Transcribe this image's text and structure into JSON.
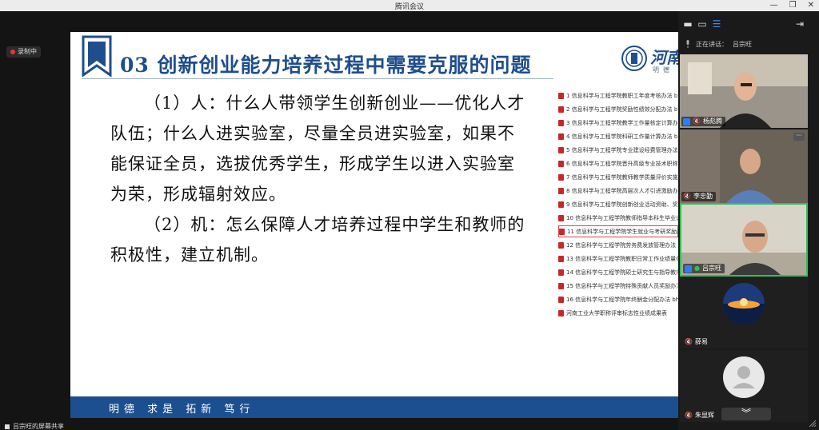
{
  "window": {
    "title": "腾讯会议",
    "controls": {
      "minimize": "—",
      "restore": "❐",
      "close": "✕"
    }
  },
  "recording": {
    "label": "录制中"
  },
  "slide": {
    "title": "03 创新创业能力培养过程中需要克服的问题",
    "logo_text": "河南",
    "logo_sub": "明德 求",
    "paragraphs": [
      [
        "（1）人：什么人带领学生创新创业——优化人才",
        "队伍；什么人进实验室，尽量全员进实验室，如果不",
        "能保证全员，选拔优秀学生，形成学生以进入实验室",
        "为荣，形成辐射效应。"
      ],
      [
        "（2）机：怎么保障人才培养过程中学生和教师的",
        "积极性，建立机制。"
      ]
    ],
    "footer_motto": "明德 求是 拓新 笃行",
    "colors": {
      "title": "#1f4e8c",
      "footer": "#1c4f8f"
    }
  },
  "file_list": {
    "items": [
      "1 信息科学与工程学院教职工年度考核办法 bh",
      "2 信息科学与工程学院奖励性绩效分配办法 bh",
      "3 信息科学与工程学院教学工作量核定计算办法",
      "4 信息科学与工程学院科研工作量计算办法 bh",
      "5 信息科学与工程学院专业建设经费管理办法 b",
      "6 信息科学与工程学院晋升高级专业技术职称入",
      "7 信息科学与工程学院教师教学质量评价实施办",
      "8 信息科学与工程学院高层次人才引进激励办法",
      "9 信息科学与工程学院创新创业活动资助、奖励",
      "10 信息科学与工程学院教师指导本科生毕业设",
      "11 信息科学与工程学院学生就业与考研奖励办",
      "12 信息科学与工程学院劳务费发放管理办法 bh",
      "13 信息科学与工程学院教职日常工作业绩量化",
      "14 信息科学与工程学院硕士研究生与指导教师",
      "15 信息科学与工程学院特殊贡献人员奖励办法",
      "16 信息科学与工程学院年终酬金分配办法 bh",
      "河南工业大学职称评审标志性业绩成果表"
    ],
    "highlighted_index": 10
  },
  "panel": {
    "speaking_label": "正在讲话：",
    "speaking_name": "吕宗旺",
    "participants": [
      {
        "name": "杨彪腾"
      },
      {
        "name": "李忠勤"
      },
      {
        "name": "吕宗旺"
      },
      {
        "name": "薛易"
      },
      {
        "name": "朱显辉"
      }
    ],
    "more_label": "···",
    "scroll_down": "︾"
  },
  "bottom_caption": "吕宗旺的屏幕共享"
}
